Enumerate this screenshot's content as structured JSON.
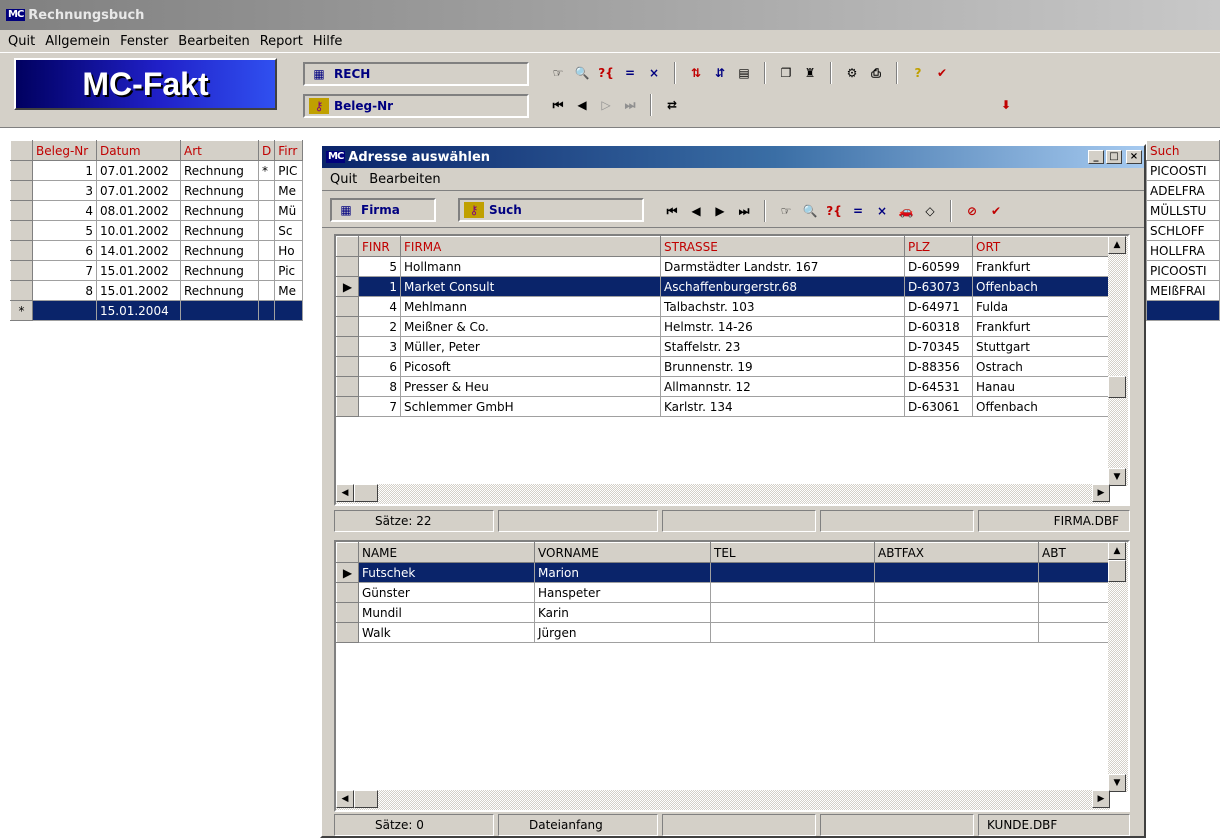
{
  "app": {
    "title": "Rechnungsbuch",
    "logo": "MC",
    "brand": "MC-Fakt"
  },
  "menu": [
    "Quit",
    "Allgemein",
    "Fenster",
    "Bearbeiten",
    "Report",
    "Hilfe"
  ],
  "toolbar": {
    "table_field": "RECH",
    "key_field": "Beleg-Nr"
  },
  "ledger": {
    "headers": [
      "Beleg-Nr",
      "Datum",
      "Art",
      "D",
      "Firr"
    ],
    "rows": [
      [
        "1",
        "07.01.2002",
        "Rechnung",
        "*",
        "PIC"
      ],
      [
        "3",
        "07.01.2002",
        "Rechnung",
        "",
        "Me"
      ],
      [
        "4",
        "08.01.2002",
        "Rechnung",
        "",
        "Mü"
      ],
      [
        "5",
        "10.01.2002",
        "Rechnung",
        "",
        "Sc"
      ],
      [
        "6",
        "14.01.2002",
        "Rechnung",
        "",
        "Ho"
      ],
      [
        "7",
        "15.01.2002",
        "Rechnung",
        "",
        "Pic"
      ],
      [
        "8",
        "15.01.2002",
        "Rechnung",
        "",
        "Me"
      ]
    ],
    "new_row": {
      "marker": "*",
      "date": "15.01.2004"
    }
  },
  "suchcol": {
    "header": "Such",
    "values": [
      "PICOOSTI",
      "ADELFRA",
      "MÜLLSTU",
      "SCHLOFF",
      "HOLLFRA",
      "PICOOSTI",
      "MEIßFRAI"
    ]
  },
  "dialog": {
    "title": "Adresse auswählen",
    "menu": [
      "Quit",
      "Bearbeiten"
    ],
    "table_field": "Firma",
    "key_field": "Such",
    "firms": {
      "headers": [
        "FINR",
        "FIRMA",
        "STRASSE",
        "PLZ",
        "ORT"
      ],
      "rows": [
        [
          "5",
          "Hollmann",
          "Darmstädter Landstr. 167",
          "D-60599",
          "Frankfurt"
        ],
        [
          "1",
          "Market Consult",
          "Aschaffenburgerstr.68",
          "D-63073",
          "Offenbach"
        ],
        [
          "4",
          "Mehlmann",
          "Talbachstr. 103",
          "D-64971",
          "Fulda"
        ],
        [
          "2",
          "Meißner & Co.",
          "Helmstr. 14-26",
          "D-60318",
          "Frankfurt"
        ],
        [
          "3",
          "Müller, Peter",
          "Staffelstr. 23",
          "D-70345",
          "Stuttgart"
        ],
        [
          "6",
          "Picosoft",
          "Brunnenstr. 19",
          "D-88356",
          "Ostrach"
        ],
        [
          "8",
          "Presser & Heu",
          "Allmannstr. 12",
          "D-64531",
          "Hanau"
        ],
        [
          "7",
          "Schlemmer GmbH",
          "Karlstr. 134",
          "D-63061",
          "Offenbach"
        ]
      ],
      "selected": 1
    },
    "status1": {
      "count": "Sätze: 22",
      "file": "FIRMA.DBF"
    },
    "contacts": {
      "headers": [
        "NAME",
        "VORNAME",
        "TEL",
        "ABTFAX",
        "ABT"
      ],
      "rows": [
        [
          "Futschek",
          "Marion"
        ],
        [
          "Günster",
          "Hanspeter"
        ],
        [
          "Mundil",
          "Karin"
        ],
        [
          "Walk",
          "Jürgen"
        ]
      ],
      "selected": 0
    },
    "status2": {
      "count": "Sätze: 0",
      "pos": "Dateianfang",
      "file": "KUNDE.DBF"
    }
  },
  "colors": {
    "selection": "#0a246a",
    "header_text": "#c00000",
    "title_bar": "#0a246a"
  }
}
